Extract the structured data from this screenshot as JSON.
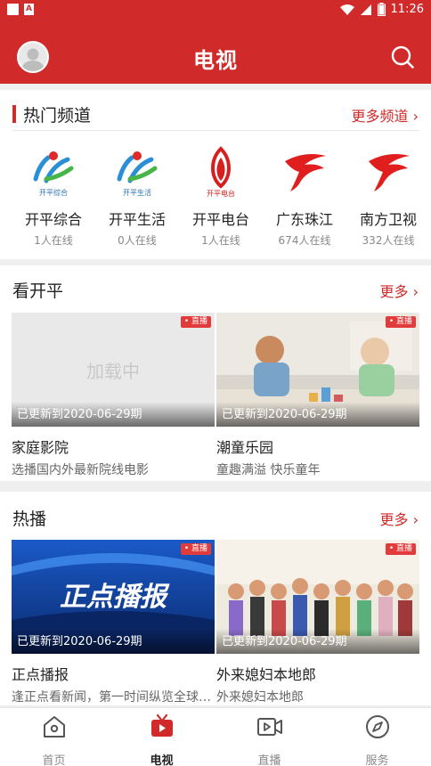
{
  "status_bar": {
    "time": "11:26"
  },
  "app_bar": {
    "title": "电视"
  },
  "hot_channels": {
    "title": "热门频道",
    "more_label": "更多频道 ›",
    "channels": [
      {
        "name": "开平综合",
        "online": "1人在线",
        "logo_text": "开平综合"
      },
      {
        "name": "开平生活",
        "online": "0人在线",
        "logo_text": "开平生活"
      },
      {
        "name": "开平电台",
        "online": "1人在线",
        "logo_text": "开平电台"
      },
      {
        "name": "广东珠江",
        "online": "674人在线"
      },
      {
        "name": "南方卫视",
        "online": "332人在线"
      }
    ]
  },
  "kan_kaiping": {
    "title": "看开平",
    "more_label": "更多 ›",
    "cards": [
      {
        "title": "家庭影院",
        "desc": "选播国内外最新院线电影",
        "updated": "已更新到2020-06-29期",
        "badge": "• 直播",
        "loading_text": "加载中"
      },
      {
        "title": "潮童乐园",
        "desc": "童趣满溢 快乐童年",
        "updated": "已更新到2020-06-29期",
        "badge": "• 直播"
      }
    ]
  },
  "hot_broadcast": {
    "title": "热播",
    "more_label": "更多 ›",
    "cards": [
      {
        "title": "正点播报",
        "desc": "逢正点看新闻，第一时间纵览全球资讯",
        "updated": "已更新到2020-06-29期",
        "badge": "• 直播",
        "thumb_text": "正点播报"
      },
      {
        "title": "外来媳妇本地郎",
        "desc": "外来媳妇本地郎",
        "updated": "已更新到2020-06-29期",
        "badge": "• 直播"
      }
    ]
  },
  "tab_bar": {
    "tabs": [
      {
        "label": "首页"
      },
      {
        "label": "电视"
      },
      {
        "label": "直播"
      },
      {
        "label": "服务"
      }
    ]
  },
  "colors": {
    "brand_red": "#d02a2a",
    "live_badge": "#e23b3b"
  }
}
